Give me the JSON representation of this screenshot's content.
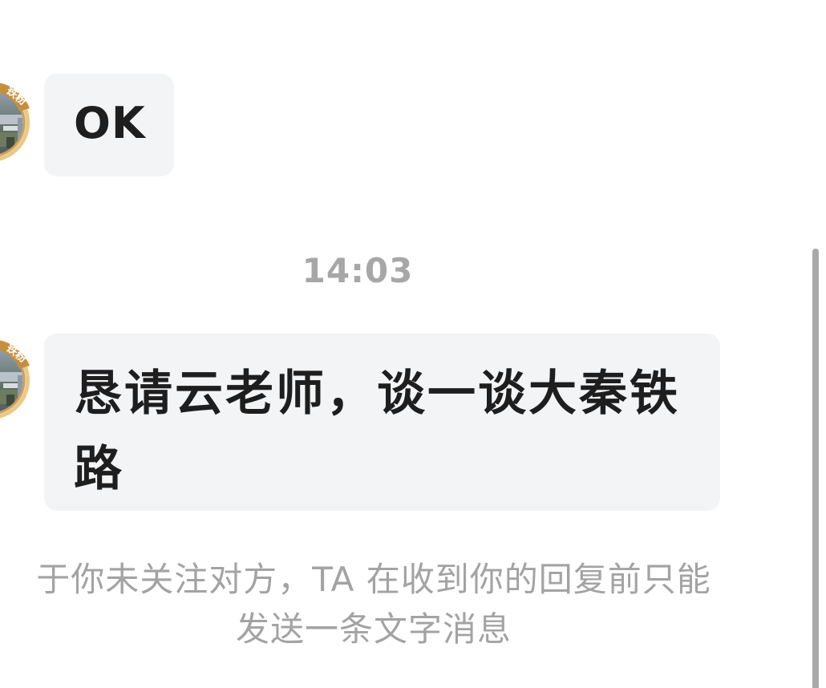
{
  "messages": [
    {
      "text": "OK",
      "sender_avatar": {
        "badge_text": "铁粉"
      }
    },
    {
      "text": "恳请云老师，谈一谈大秦铁路",
      "sender_avatar": {
        "badge_text": "铁粉"
      }
    }
  ],
  "timestamp": "14:03",
  "notice": {
    "line1": "于你未关注对方，TA 在收到你的回复前只能",
    "line2": "发送一条文字消息"
  },
  "colors": {
    "bubble_bg": "#f3f4f6",
    "bubble_text": "#1e1e1e",
    "meta_text": "#a7a7a7",
    "badge_gold": "#d9b06a",
    "scrollbar": "#a9a9a9"
  },
  "icons": {
    "avatar": "user-avatar-photo",
    "badge": "fan-badge-icon"
  }
}
